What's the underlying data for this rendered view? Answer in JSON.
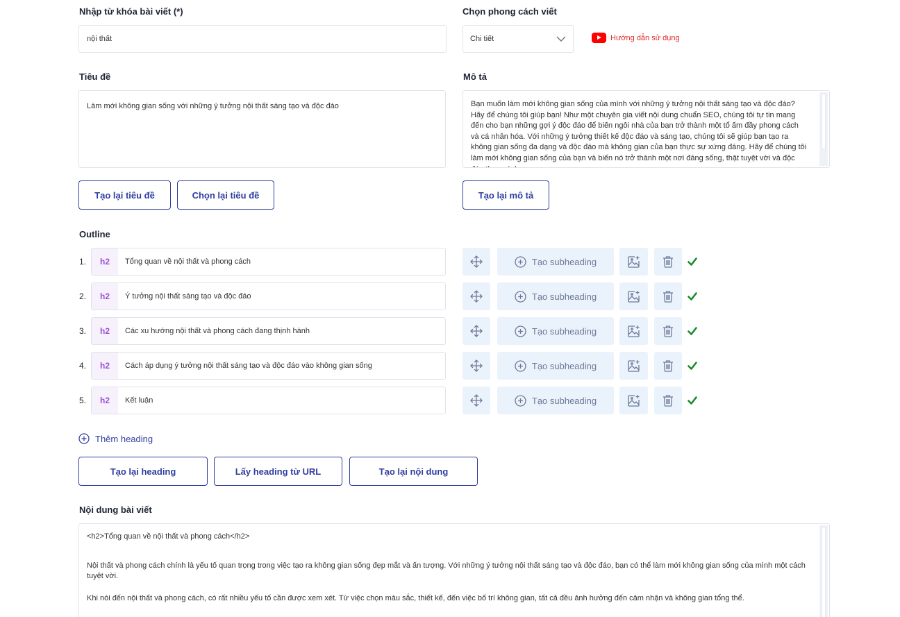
{
  "keyword": {
    "label": "Nhập từ khóa bài viết (*)",
    "value": "nội thất"
  },
  "style": {
    "label": "Chọn phong cách viết",
    "selected": "Chi tiết"
  },
  "guide": {
    "label": "Hướng dẫn sử dụng",
    "icon": "youtube-icon"
  },
  "title": {
    "label": "Tiêu đề",
    "value": "Làm mới không gian sống với những ý tưởng nội thất sáng tạo và độc đáo",
    "regen_button": "Tạo lại tiêu đề",
    "choose_button": "Chọn lại tiêu đề"
  },
  "description": {
    "label": "Mô tả",
    "value": "Bạn muốn làm mới không gian sống của mình với những ý tưởng nội thất sáng tạo và độc đáo? Hãy để chúng tôi giúp bạn! Như một chuyên gia viết nội dung chuẩn SEO, chúng tôi tự tin mang đến cho bạn những gợi ý độc đáo để biến ngôi nhà của bạn trở thành một tổ ấm đầy phong cách và cá nhân hóa. Với những ý tưởng thiết kế độc đáo và sáng tạo, chúng tôi sẽ giúp bạn tạo ra không gian sống đa dạng và độc đáo mà không gian của bạn thực sự xứng đáng. Hãy để chúng tôi làm mới không gian sống của bạn và biến nó trở thành một nơi đáng sống, thật tuyệt vời và độc đáo theo cách",
    "regen_button": "Tạo lại mô tả"
  },
  "outline": {
    "label": "Outline",
    "subheading_button": "Tạo subheading",
    "items": [
      {
        "num": "1.",
        "tag": "h2",
        "text": "Tổng quan về nội thất và phong cách"
      },
      {
        "num": "2.",
        "tag": "h2",
        "text": "Ý tưởng nội thất sáng tạo và độc đáo"
      },
      {
        "num": "3.",
        "tag": "h2",
        "text": "Các xu hướng nội thất và phong cách đang thịnh hành"
      },
      {
        "num": "4.",
        "tag": "h2",
        "text": "Cách áp dụng ý tưởng nội thất sáng tạo và độc đáo vào không gian sống"
      },
      {
        "num": "5.",
        "tag": "h2",
        "text": "Kết luận"
      }
    ],
    "add_heading": "Thêm heading",
    "regen_heading_button": "Tạo lại heading",
    "url_heading_button": "Lấy heading từ URL",
    "regen_content_button": "Tạo lại nội dung"
  },
  "content": {
    "label": "Nội dung bài viết",
    "line1": "<h2>Tổng quan về nội thất và phong cách</h2>",
    "para1": "Nội thất và phong cách chính là yếu tố quan trọng trong việc tạo ra không gian sống đẹp mắt và ấn tượng. Với những ý tưởng nội thất sáng tạo và độc đáo, bạn có thể làm mới không gian sống của mình một cách tuyệt vời.",
    "para2": "Khi nói đến nội thất và phong cách, có rất nhiều yếu tố cần được xem xét. Từ việc chọn màu sắc, thiết kế, đến việc bố trí không gian, tất cả đều ảnh hưởng đến cảm nhận và không gian tổng thể."
  },
  "colors": {
    "accent": "#2f3e9e",
    "tag": "#9b4fd6",
    "action_bg": "#eaf2fc",
    "check": "#1a8a2a"
  }
}
